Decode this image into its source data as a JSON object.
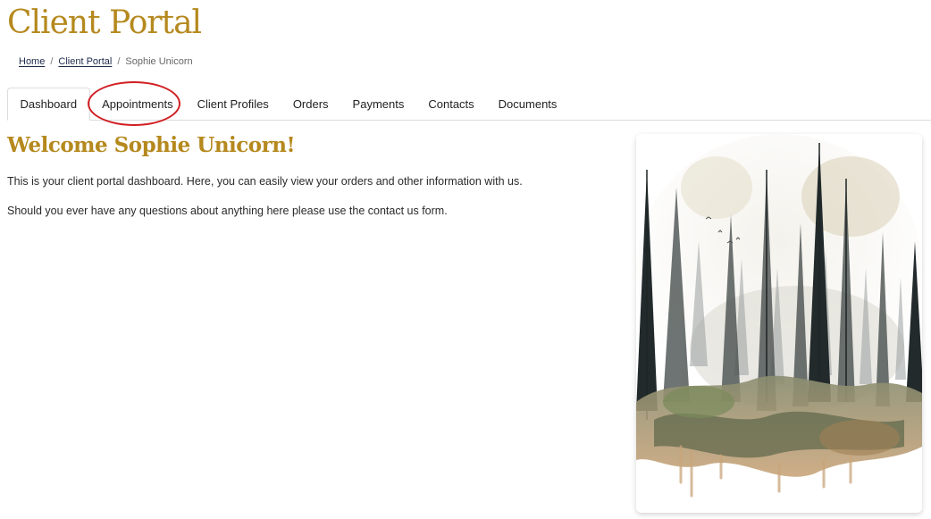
{
  "header": {
    "title": "Client Portal"
  },
  "breadcrumb": {
    "items": [
      {
        "label": "Home"
      },
      {
        "label": "Client Portal"
      }
    ],
    "current": "Sophie Unicorn",
    "separator": "/"
  },
  "tabs": [
    {
      "label": "Dashboard",
      "active": true
    },
    {
      "label": "Appointments",
      "highlighted": true
    },
    {
      "label": "Client Profiles"
    },
    {
      "label": "Orders"
    },
    {
      "label": "Payments"
    },
    {
      "label": "Contacts"
    },
    {
      "label": "Documents"
    }
  ],
  "main": {
    "welcome": "Welcome Sophie Unicorn!",
    "paragraphs": [
      "This is your client portal dashboard. Here, you can easily view your orders and other information with us.",
      "Should you ever have any questions about anything here please use the contact us form."
    ]
  },
  "image": {
    "subject": "watercolor-forest-illustration"
  },
  "colors": {
    "brand_gold": "#b5891e",
    "highlight_red": "#d11f24",
    "tab_border": "#dcdcdc"
  }
}
